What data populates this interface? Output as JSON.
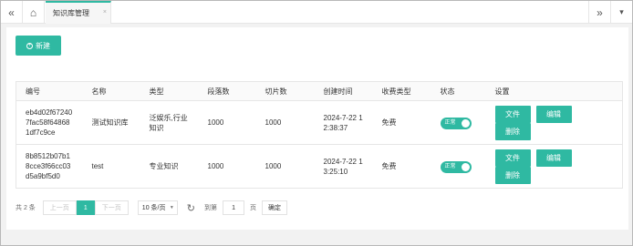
{
  "tabs": [
    {
      "label": "知识库管理",
      "close": "×"
    }
  ],
  "toolbar": {
    "new_label": "新建",
    "nav_left": "«",
    "nav_right": "»",
    "home": "⌂",
    "menu": "▾"
  },
  "table": {
    "headers": [
      "编号",
      "名称",
      "类型",
      "段落数",
      "切片数",
      "创建时间",
      "收费类型",
      "状态",
      "设置"
    ],
    "rows": [
      {
        "id": "eb4d02f672407fac58f648681df7c9ce",
        "name": "测试知识库",
        "type": "泛娱乐,行业知识",
        "paragraphs": "1000",
        "slices": "1000",
        "created": "2024-7-22 12:38:37",
        "fee": "免费",
        "status": "正常"
      },
      {
        "id": "8b8512b07b18cce3f66cc03d5a9bf5d0",
        "name": "test",
        "type": "专业知识",
        "paragraphs": "1000",
        "slices": "1000",
        "created": "2024-7-22 13:25:10",
        "fee": "免费",
        "status": "正常"
      }
    ],
    "actions": {
      "file": "文件",
      "edit": "编辑",
      "delete": "删除"
    }
  },
  "pagination": {
    "total": "共 2 条",
    "prev": "上一页",
    "current": "1",
    "next": "下一页",
    "page_size": "10 条/页",
    "goto_label": "到第",
    "goto_value": "1",
    "page_unit": "页",
    "confirm": "确定"
  },
  "colors": {
    "accent": "#2fb9a2"
  }
}
